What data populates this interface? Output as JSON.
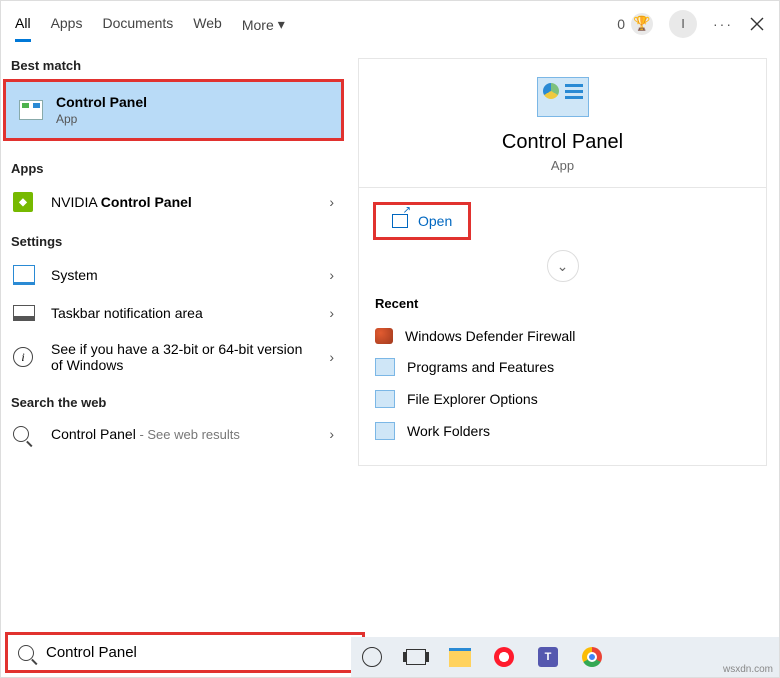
{
  "header": {
    "tabs": [
      "All",
      "Apps",
      "Documents",
      "Web",
      "More"
    ],
    "rewards": "0",
    "avatar_initial": "I"
  },
  "left": {
    "best_match_label": "Best match",
    "best_match": {
      "title": "Control Panel",
      "subtitle": "App"
    },
    "apps_label": "Apps",
    "apps": [
      {
        "prefix": "NVIDIA ",
        "bold": "Control Panel"
      }
    ],
    "settings_label": "Settings",
    "settings": [
      "System",
      "Taskbar notification area",
      "See if you have a 32-bit or 64-bit version of Windows"
    ],
    "web_label": "Search the web",
    "web": {
      "term": "Control Panel",
      "suffix": " - See web results"
    }
  },
  "right": {
    "title": "Control Panel",
    "subtitle": "App",
    "open_label": "Open",
    "recent_label": "Recent",
    "recent": [
      "Windows Defender Firewall",
      "Programs and Features",
      "File Explorer Options",
      "Work Folders"
    ]
  },
  "search": {
    "value": "Control Panel"
  },
  "watermark": "wsxdn.com"
}
